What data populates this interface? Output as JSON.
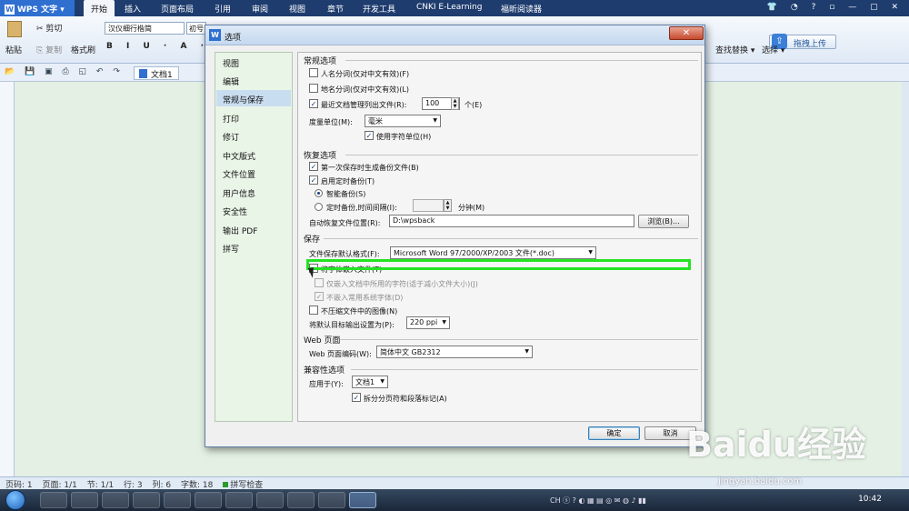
{
  "app": {
    "logo": "WPS 文字",
    "menu_tabs": [
      "开始",
      "插入",
      "页面布局",
      "引用",
      "审阅",
      "视图",
      "章节",
      "开发工具",
      "CNKI E-Learning",
      "福昕阅读器"
    ],
    "active_tab": "开始"
  },
  "ribbon": {
    "paste": "粘贴",
    "cut": "剪切",
    "copy": "复制",
    "format_painter": "格式刷",
    "font_name": "汉仪细行楷简",
    "font_size": "初号",
    "find_replace": "查找替换",
    "select": "选择",
    "upload": "拖拽上传"
  },
  "document_tab": "文档1",
  "dialog": {
    "title": "选项",
    "close_glyph": "✕",
    "nav_items": [
      "视图",
      "编辑",
      "常规与保存",
      "打印",
      "修订",
      "中文版式",
      "文件位置",
      "用户信息",
      "安全性",
      "输出 PDF",
      "拼写"
    ],
    "selected_nav": "常规与保存",
    "general": {
      "title": "常规选项",
      "name_segmentation": "人名分词(仅对中文有效)(F)",
      "place_segmentation": "地名分词(仅对中文有效)(L)",
      "recent_files": "最近文档管理列出文件(R):",
      "recent_files_count": "100",
      "recent_files_unit": "个(E)",
      "measure_unit_label": "度量单位(M):",
      "measure_unit_value": "毫米",
      "use_char_unit": "使用字符单位(H)"
    },
    "recovery": {
      "title": "恢复选项",
      "first_save_backup": "第一次保存时生成备份文件(B)",
      "enable_timed_backup": "启用定时备份(T)",
      "smart_backup": "智能备份(S)",
      "timed_backup_interval": "定时备份,时间间隔(I):",
      "interval_value": "",
      "minutes": "分钟(M)",
      "autorecover_location_label": "自动恢复文件位置(R):",
      "autorecover_location_value": "D:\\wpsback",
      "browse": "浏览(B)..."
    },
    "save": {
      "title": "保存",
      "default_format_label": "文件保存默认格式(F):",
      "default_format_value": "Microsoft Word 97/2000/XP/2003 文件(*.doc)",
      "embed_fonts": "将字体嵌入文件(T)",
      "embed_used_chars_only": "仅嵌入文档中所用的字符(适于减小文件大小)(J)",
      "no_common_fonts": "不嵌入常用系统字体(D)",
      "no_compress_images": "不压缩文件中的图像(N)",
      "default_output_label": "将默认目标输出设置为(P):",
      "default_output_value": "220 ppi"
    },
    "web": {
      "title": "Web 页面",
      "encoding_label": "Web 页面编码(W):",
      "encoding_value": "简体中文 GB2312"
    },
    "compat": {
      "title": "兼容性选项",
      "apply_to_label": "应用于(Y):",
      "apply_to_value": "文档1",
      "split_page_marks": "拆分分页符和段落标记(A)"
    },
    "ok": "确定",
    "cancel": "取消"
  },
  "statusbar": {
    "page": "页码: 1",
    "pages": "页面: 1/1",
    "section": "节: 1/1",
    "row": "行: 3",
    "column": "列: 6",
    "word_count": "字数: 18",
    "spell_check": "拼写检查"
  },
  "taskbar": {
    "clock": "10:42"
  },
  "watermark": {
    "brand": "Baidu经验",
    "url": "jingyan.baidu.com"
  },
  "colors": {
    "title_blue": "#1e3c6e",
    "highlight_green": "#22e422",
    "nav_bg": "#e9f5e7"
  }
}
